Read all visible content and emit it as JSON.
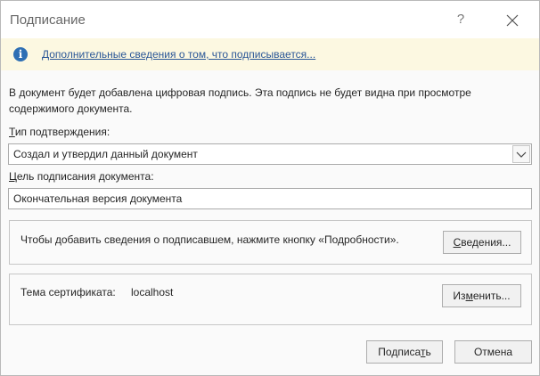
{
  "window": {
    "title": "Подписание",
    "help_label": "?"
  },
  "infobar": {
    "icon": "info-icon",
    "icon_glyph": "i",
    "link_text": "Дополнительные сведения о том, что подписывается..."
  },
  "description": "В документ будет добавлена цифровая подпись. Эта подпись не будет видна при просмотре содержимого документа.",
  "commitment": {
    "label_first": "Т",
    "label_rest": "ип подтверждения:",
    "selected": "Создал и утвердил данный документ"
  },
  "purpose": {
    "label_first": "Ц",
    "label_rest": "ель подписания документа:",
    "value": "Окончательная версия документа"
  },
  "signer": {
    "text": "Чтобы добавить сведения о подписавшем, нажмите кнопку «Подробности».",
    "details_button_first": "С",
    "details_button_rest": "ведения..."
  },
  "certificate": {
    "label": "Тема сертификата:",
    "value": "localhost",
    "change_button_a": "Из",
    "change_button_u": "м",
    "change_button_b": "енить..."
  },
  "footer": {
    "sign_button_a": "Подписа",
    "sign_button_u": "т",
    "sign_button_b": "ь",
    "cancel_button": "Отмена"
  },
  "colors": {
    "infobar_bg": "#fcf8e1",
    "link": "#2b5797",
    "info_icon": "#2e6fb4"
  }
}
